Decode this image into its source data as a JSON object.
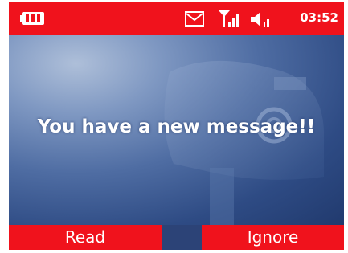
{
  "status_bar": {
    "time": "03:52",
    "battery_icon": "battery-icon",
    "message_icon": "envelope-icon",
    "signal_icon": "signal-strength-icon",
    "volume_icon": "speaker-volume-icon"
  },
  "notification": {
    "text": "You have a new message!!"
  },
  "softkeys": {
    "left_label": "Read",
    "right_label": "Ignore"
  },
  "colors": {
    "accent_red": "#f0121c",
    "background_blue": "#3b5b91",
    "text_white": "#ffffff"
  }
}
